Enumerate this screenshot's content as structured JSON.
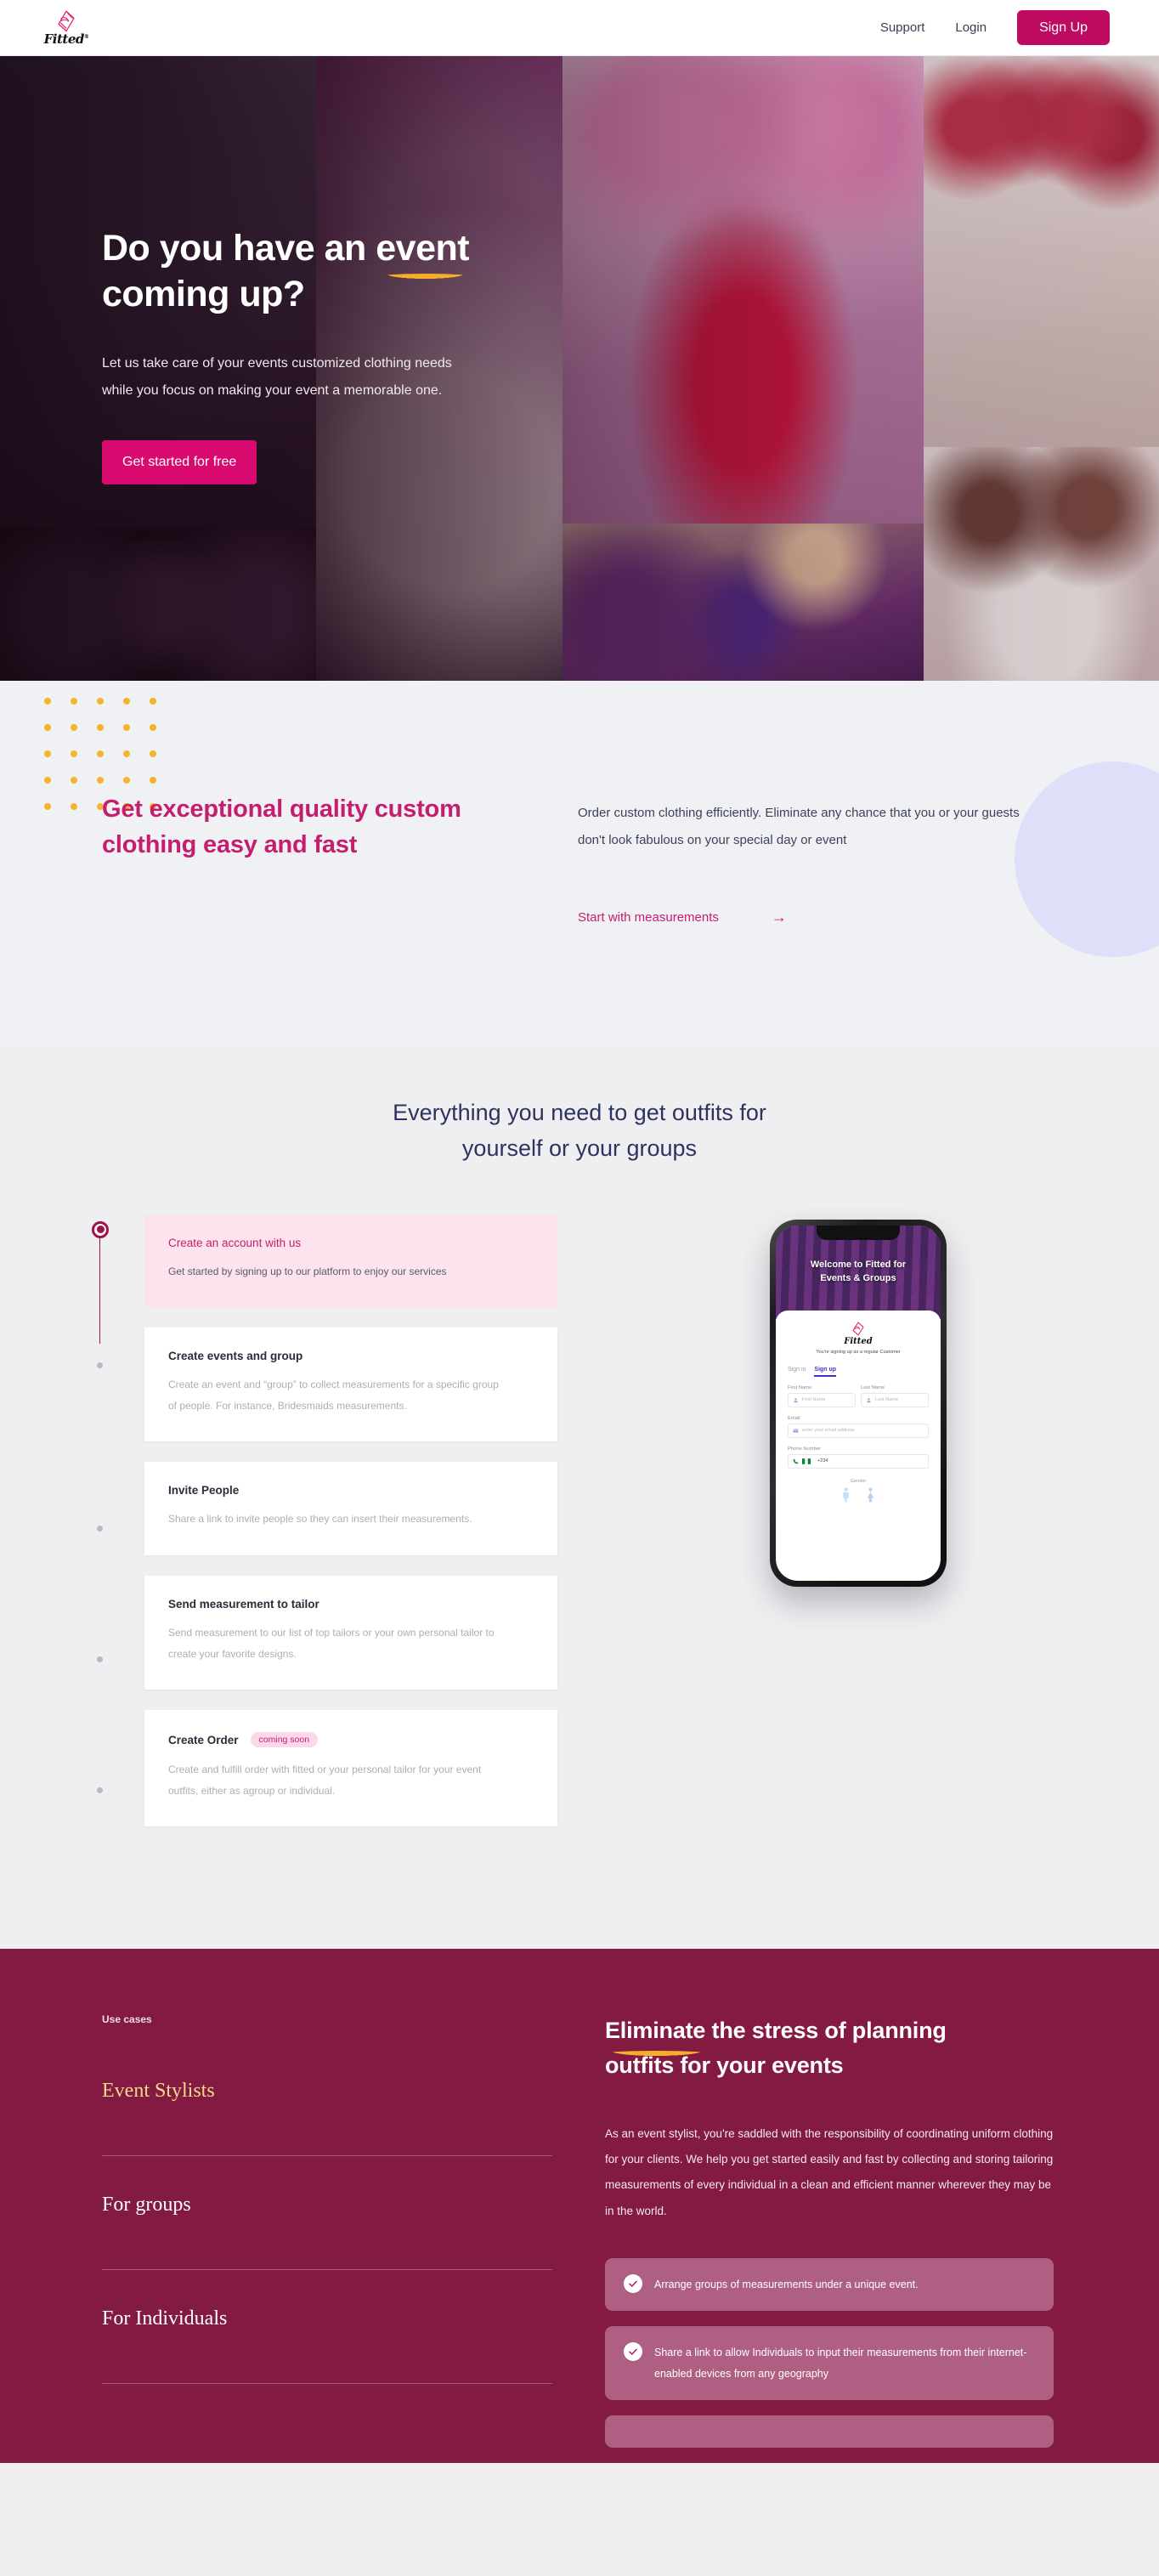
{
  "brand": {
    "name": "Fitted",
    "trademark": "®",
    "accent": "#BE0A60",
    "maroon": "#821A42",
    "gold": "#F5AE2C"
  },
  "header": {
    "logo_icon": "fitted-dress-tag-logo",
    "nav": [
      {
        "label": "Support",
        "name": "nav-support"
      },
      {
        "label": "Login",
        "name": "nav-login"
      }
    ],
    "signup_label": "Sign Up"
  },
  "hero": {
    "title_line1_a": "Do you have an ",
    "title_line1_b": "event",
    "title_line2": "coming up?",
    "subtitle_line1": "Let us take care of your events customized clothing needs",
    "subtitle_line2": "while you focus on making your event a memorable one.",
    "cta_label": "Get started for free"
  },
  "quality": {
    "heading_line1": "Get exceptional quality custom",
    "heading_line2": "clothing easy and fast",
    "paragraph": "Order custom clothing efficiently. Eliminate any chance that you or your guests don't look fabulous on your special day or event",
    "link_label": "Start with measurements",
    "link_arrow": "→"
  },
  "steps": {
    "heading_line1": "Everything you need to get outfits for",
    "heading_line2": "yourself or your groups",
    "items": [
      {
        "title": "Create an account with us",
        "desc": "Get started by signing up to our platform to enjoy our services",
        "badge": "",
        "active": true
      },
      {
        "title": "Create events and group",
        "desc": "Create an event and “group” to collect measurements for a specific group of people. For instance, Bridesmaids measurements.",
        "badge": "",
        "active": false
      },
      {
        "title": "Invite People",
        "desc": "Share a link to invite people so they can insert their measurements.",
        "badge": "",
        "active": false
      },
      {
        "title": "Send measurement to tailor",
        "desc": "Send measurement to our list of top tailors or your own personal tailor to create your favorite designs.",
        "badge": "",
        "active": false
      },
      {
        "title": "Create Order",
        "desc": "Create and fulfill order with fitted or your personal tailor for your event outfits, either as agroup or individual.",
        "badge": "coming soon",
        "active": false
      }
    ]
  },
  "phone": {
    "hero_line1": "Welcome to Fitted for",
    "hero_line2": "Events & Groups",
    "logo_word": "Fitted",
    "note": "You're signing up as a regular Customer",
    "tab_signin": "Sign in",
    "tab_signup": "Sign up",
    "label_first": "First Name",
    "ph_first": "First Name",
    "label_last": "Last Name",
    "ph_last": "Last Name",
    "label_email": "Email",
    "ph_email": "enter your email address",
    "label_phone": "Phone Number",
    "phone_code": "+234",
    "label_gender": "Gender",
    "gender_m": "M",
    "gender_f": "F"
  },
  "usecases": {
    "kicker": "Use cases",
    "items": [
      {
        "label": "Event Stylists",
        "active": true
      },
      {
        "label": "For groups",
        "active": false
      },
      {
        "label": "For Individuals",
        "active": false
      }
    ],
    "heading_a": "Eliminate",
    "heading_b": " the stress of planning",
    "heading_line2": "outfits for your events",
    "paragraph": "As an event stylist, you're saddled with the responsibility of coordinating uniform clothing for your clients. We help you get started easily and fast by collecting and storing tailoring measurements of every individual in a clean and efficient manner wherever they may be in the world.",
    "pills": [
      {
        "text": "Arrange groups of measurements under a unique event."
      },
      {
        "text": "Share a link to allow Individuals to input their measurements from their internet-enabled devices from any geography"
      },
      {
        "text": ""
      }
    ]
  }
}
